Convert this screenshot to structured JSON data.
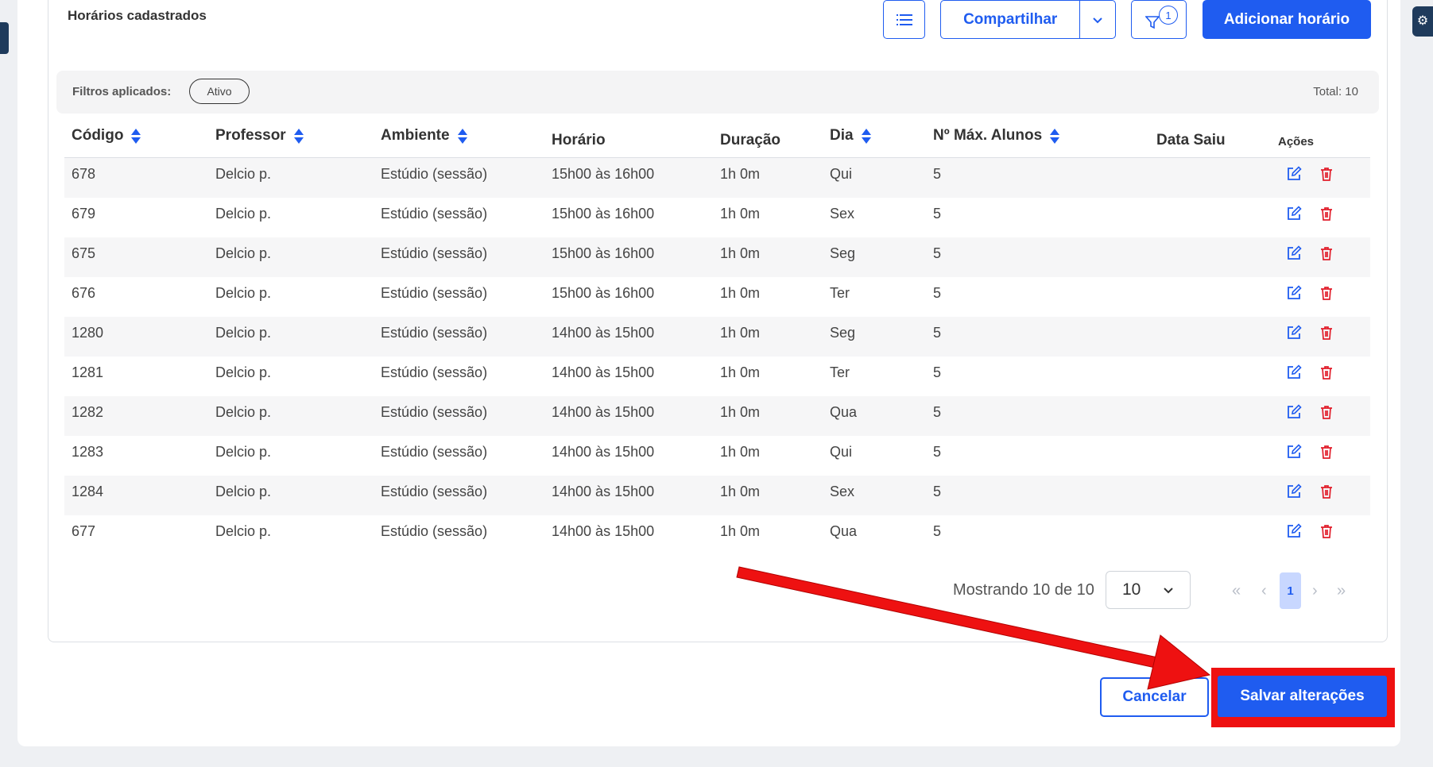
{
  "header": {
    "title": "Horários cadastrados",
    "share_label": "Compartilhar",
    "filter_badge_count": "1",
    "add_label": "Adicionar horário"
  },
  "filters": {
    "label": "Filtros aplicados:",
    "chip": "Ativo",
    "total": "Total: 10"
  },
  "table": {
    "columns": [
      "Código",
      "Professor",
      "Ambiente",
      "Horário",
      "Duração",
      "Dia",
      "Nº Máx. Alunos",
      "Data Saiu",
      "Ações"
    ],
    "rows": [
      [
        "678",
        "Delcio p.",
        "Estúdio (sessão)",
        "15h00 às 16h00",
        "1h 0m",
        "Qui",
        "5",
        ""
      ],
      [
        "679",
        "Delcio p.",
        "Estúdio (sessão)",
        "15h00 às 16h00",
        "1h 0m",
        "Sex",
        "5",
        ""
      ],
      [
        "675",
        "Delcio p.",
        "Estúdio (sessão)",
        "15h00 às 16h00",
        "1h 0m",
        "Seg",
        "5",
        ""
      ],
      [
        "676",
        "Delcio p.",
        "Estúdio (sessão)",
        "15h00 às 16h00",
        "1h 0m",
        "Ter",
        "5",
        ""
      ],
      [
        "1280",
        "Delcio p.",
        "Estúdio (sessão)",
        "14h00 às 15h00",
        "1h 0m",
        "Seg",
        "5",
        ""
      ],
      [
        "1281",
        "Delcio p.",
        "Estúdio (sessão)",
        "14h00 às 15h00",
        "1h 0m",
        "Ter",
        "5",
        ""
      ],
      [
        "1282",
        "Delcio p.",
        "Estúdio (sessão)",
        "14h00 às 15h00",
        "1h 0m",
        "Qua",
        "5",
        ""
      ],
      [
        "1283",
        "Delcio p.",
        "Estúdio (sessão)",
        "14h00 às 15h00",
        "1h 0m",
        "Qui",
        "5",
        ""
      ],
      [
        "1284",
        "Delcio p.",
        "Estúdio (sessão)",
        "14h00 às 15h00",
        "1h 0m",
        "Sex",
        "5",
        ""
      ],
      [
        "677",
        "Delcio p.",
        "Estúdio (sessão)",
        "14h00 às 15h00",
        "1h 0m",
        "Qua",
        "5",
        ""
      ]
    ]
  },
  "pagination": {
    "showing": "Mostrando 10 de 10",
    "page_size": "10",
    "first": "«",
    "prev": "‹",
    "current": "1",
    "next": "›",
    "last": "»"
  },
  "footer": {
    "cancel_label": "Cancelar",
    "save_label": "Salvar alterações"
  },
  "colors": {
    "primary": "#1f5cf0",
    "delete": "#e11d2a",
    "annotation": "#ee1111"
  },
  "icons": {
    "list": "list-icon",
    "filter": "filter-icon",
    "edit": "edit-icon",
    "delete": "trash-icon",
    "sort": "sort-icon",
    "chevron": "chevron-down-icon"
  }
}
